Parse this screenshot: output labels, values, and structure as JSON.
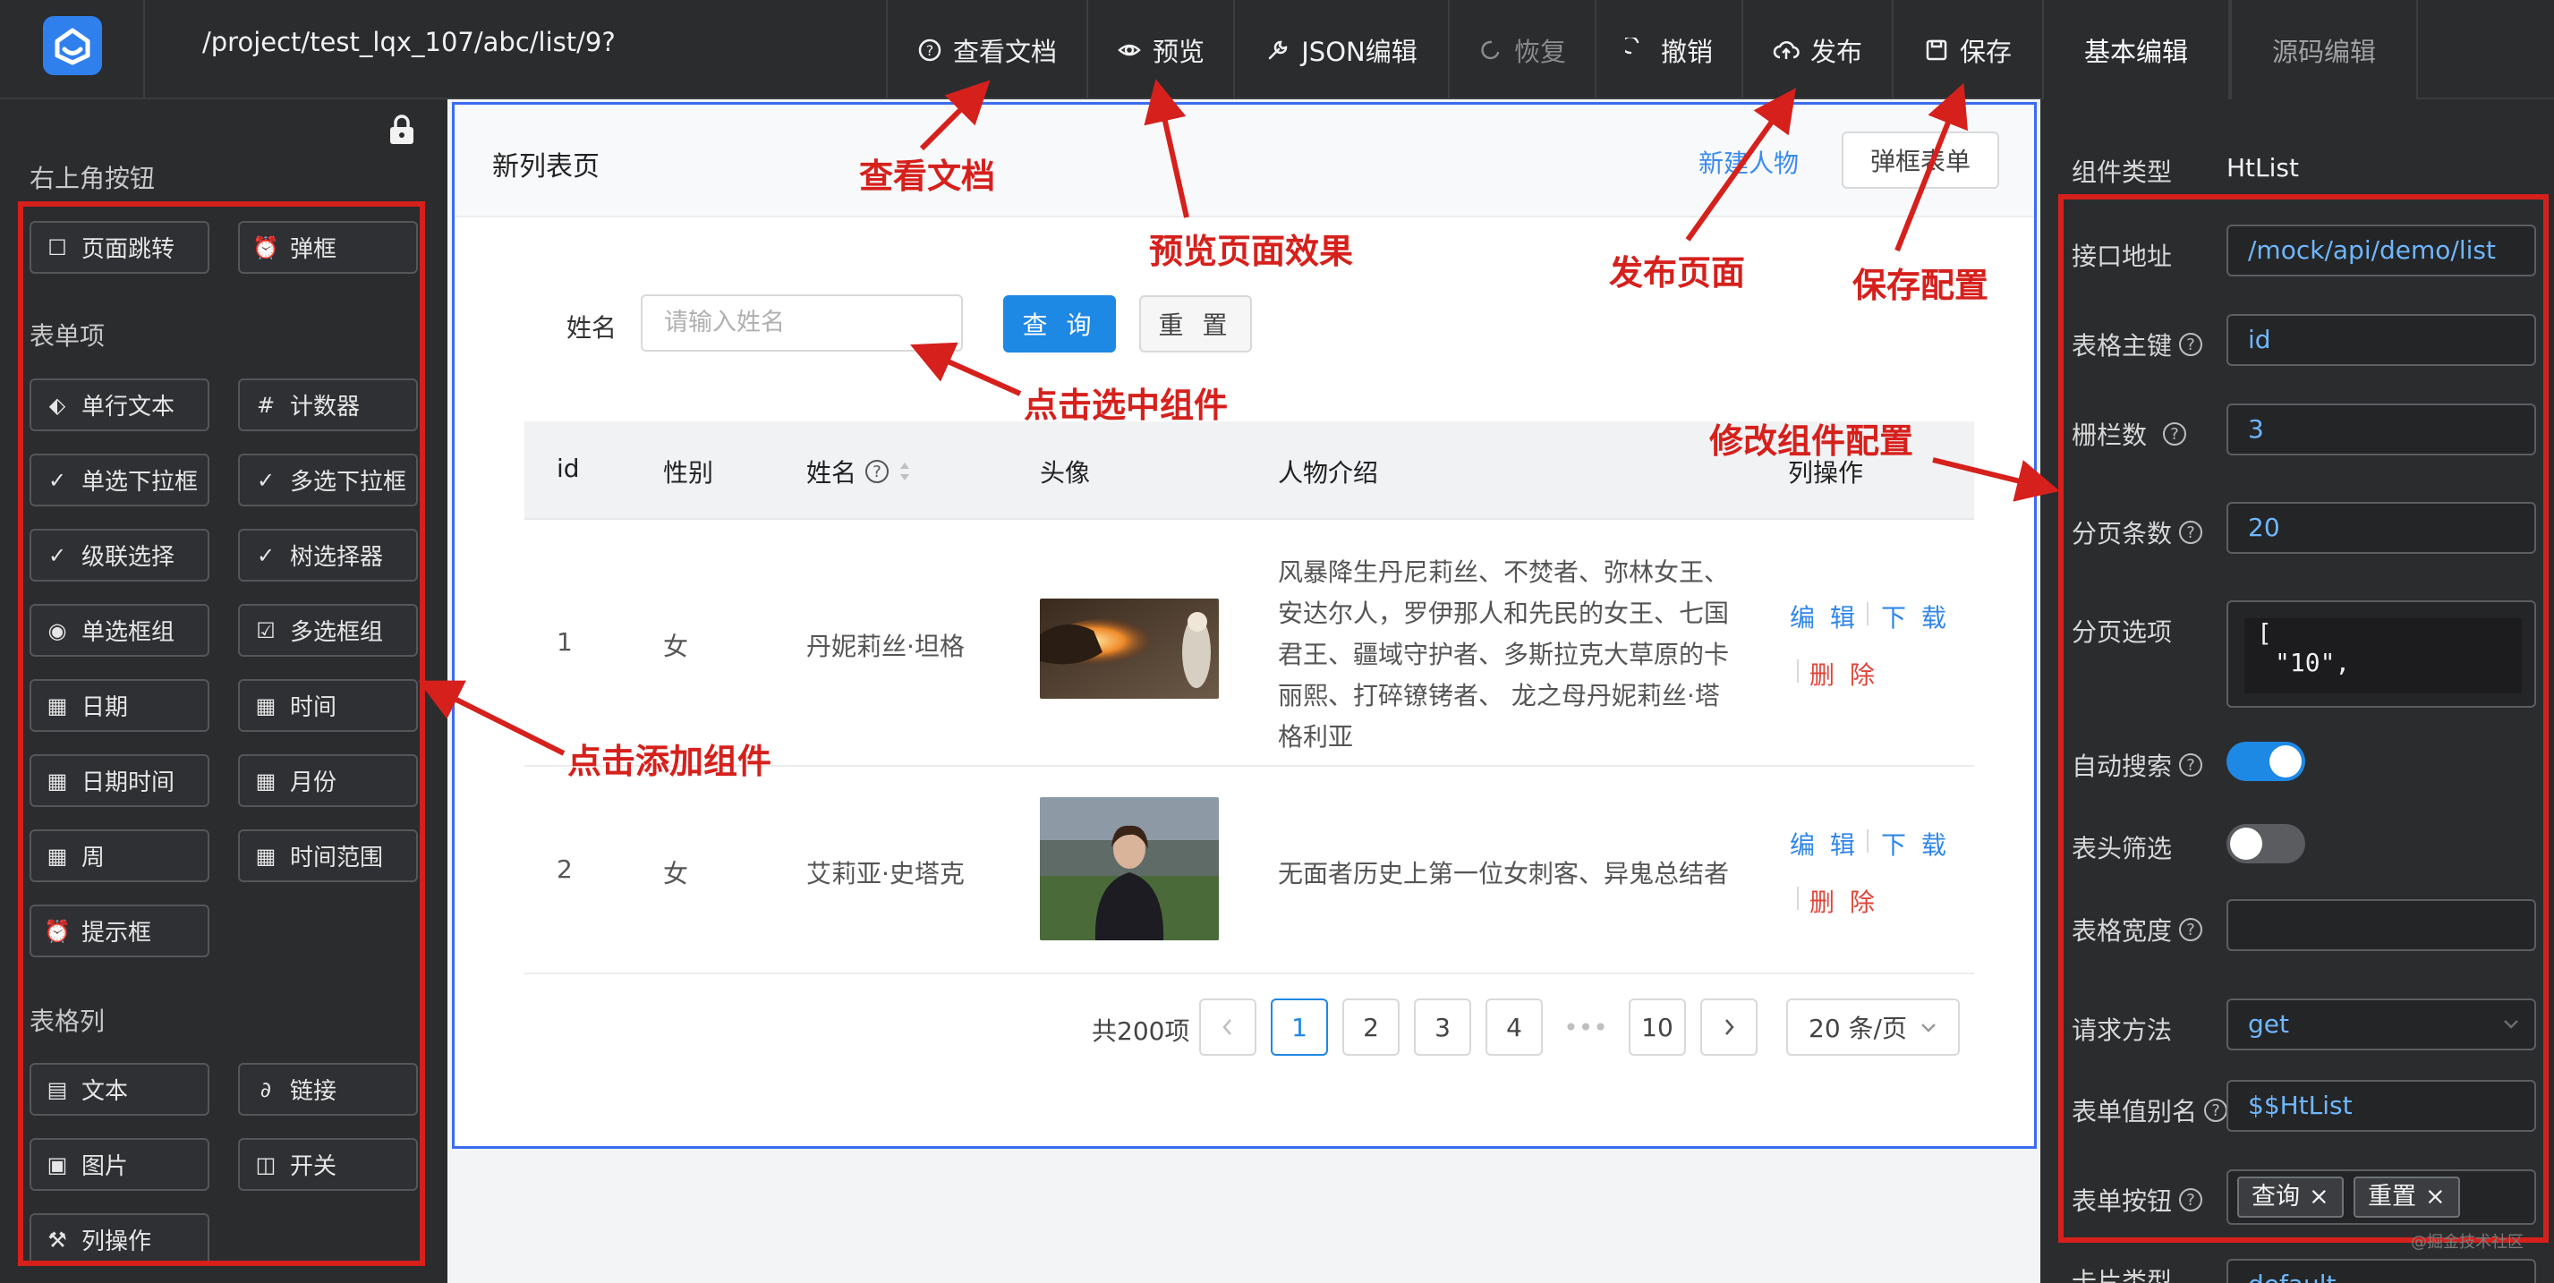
{
  "topbar": {
    "path": "/project/test_lqx_107/abc/list/9?",
    "buttons": {
      "docs": "查看文档",
      "preview": "预览",
      "json_edit": "JSON编辑",
      "restore": "恢复",
      "undo": "撤销",
      "publish": "发布",
      "save": "保存"
    },
    "tabs": {
      "basic": "基本编辑",
      "source": "源码编辑"
    }
  },
  "left": {
    "section_corner": "右上角按钮",
    "section_form": "表单项",
    "section_table": "表格列",
    "corner_items": [
      {
        "label": "页面跳转",
        "icon": "square-icon"
      },
      {
        "label": "弹框",
        "icon": "alarm-icon"
      }
    ],
    "form_items": [
      {
        "label": "单行文本",
        "icon": "tag-icon"
      },
      {
        "label": "计数器",
        "icon": "hash-icon"
      },
      {
        "label": "单选下拉框",
        "icon": "check-icon"
      },
      {
        "label": "多选下拉框",
        "icon": "check-icon"
      },
      {
        "label": "级联选择",
        "icon": "check-icon"
      },
      {
        "label": "树选择器",
        "icon": "check-icon"
      },
      {
        "label": "单选框组",
        "icon": "check-circle-icon"
      },
      {
        "label": "多选框组",
        "icon": "check-square-icon"
      },
      {
        "label": "日期",
        "icon": "calendar-icon"
      },
      {
        "label": "时间",
        "icon": "calendar-icon"
      },
      {
        "label": "日期时间",
        "icon": "calendar-icon"
      },
      {
        "label": "月份",
        "icon": "calendar-icon"
      },
      {
        "label": "周",
        "icon": "calendar-icon"
      },
      {
        "label": "时间范围",
        "icon": "calendar-icon"
      },
      {
        "label": "提示框",
        "icon": "alarm-icon"
      }
    ],
    "table_items": [
      {
        "label": "文本",
        "icon": "book-icon"
      },
      {
        "label": "链接",
        "icon": "paperclip-icon"
      },
      {
        "label": "图片",
        "icon": "file-image-icon"
      },
      {
        "label": "开关",
        "icon": "switch-icon"
      },
      {
        "label": "列操作",
        "icon": "wrench-icon"
      }
    ]
  },
  "card": {
    "title": "新列表页",
    "new_link": "新建人物",
    "dialog_btn": "弹框表单",
    "search_label": "姓名",
    "search_placeholder": "请输入姓名",
    "query_btn": "查 询",
    "reset_btn": "重 置",
    "columns": [
      "id",
      "性别",
      "姓名",
      "头像",
      "人物介绍",
      "列操作"
    ],
    "rows": [
      {
        "id": "1",
        "gender": "女",
        "name": "丹妮莉丝·坦格",
        "intro_lines": [
          "风暴降生丹尼莉丝、不焚者、弥林女王、",
          "安达尔人，罗伊那人和先民的女王、七国",
          "君王、疆域守护者、多斯拉克大草原的卡",
          "丽熙、打碎镣铐者、 龙之母丹妮莉丝·塔",
          "格利亚"
        ],
        "image": "dragon-photo"
      },
      {
        "id": "2",
        "gender": "女",
        "name": "艾莉亚·史塔克",
        "intro_lines": [
          "无面者历史上第一位女刺客、异鬼总结者"
        ],
        "image": "portrait-photo"
      }
    ],
    "actions": {
      "edit": "编 辑",
      "download": "下 载",
      "delete": "删 除"
    },
    "pagination": {
      "total": "共200项",
      "pages": [
        "1",
        "2",
        "3",
        "4"
      ],
      "ellipsis": "•••",
      "last": "10",
      "current": "1",
      "size": "20 条/页"
    }
  },
  "right": {
    "component_type_label": "组件类型",
    "component_type_value": "HtList",
    "fields": {
      "api_label": "接口地址",
      "api_value": "/mock/api/demo/list",
      "pk_label": "表格主键",
      "pk_value": "id",
      "grid_label": "栅栏数",
      "grid_value": "3",
      "page_size_label": "分页条数",
      "page_size_value": "20",
      "page_opts_label": "分页选项",
      "page_opts_line1": "[",
      "page_opts_line2": "\"10\",",
      "auto_search_label": "自动搜索",
      "auto_search_on": true,
      "header_filter_label": "表头筛选",
      "header_filter_on": false,
      "table_width_label": "表格宽度",
      "table_width_value": "",
      "method_label": "请求方法",
      "method_value": "get",
      "alias_label": "表单值别名",
      "alias_value": "$$HtList",
      "form_btns_label": "表单按钮",
      "form_btns": [
        "查询",
        "重置"
      ],
      "card_type_label": "卡片类型",
      "card_type_value": "default"
    }
  },
  "annotations": {
    "docs": "查看文档",
    "preview": "预览页面效果",
    "publish": "发布页面",
    "save": "保存配置",
    "select": "点击选中组件",
    "modify": "修改组件配置",
    "add": "点击添加组件"
  },
  "watermark": "@掘金技术社区",
  "colors": {
    "accent": "#1e88e5",
    "annotation": "#d6201c",
    "panel": "#2b2c2e",
    "link": "#2f86e8",
    "danger": "#e0453a"
  }
}
